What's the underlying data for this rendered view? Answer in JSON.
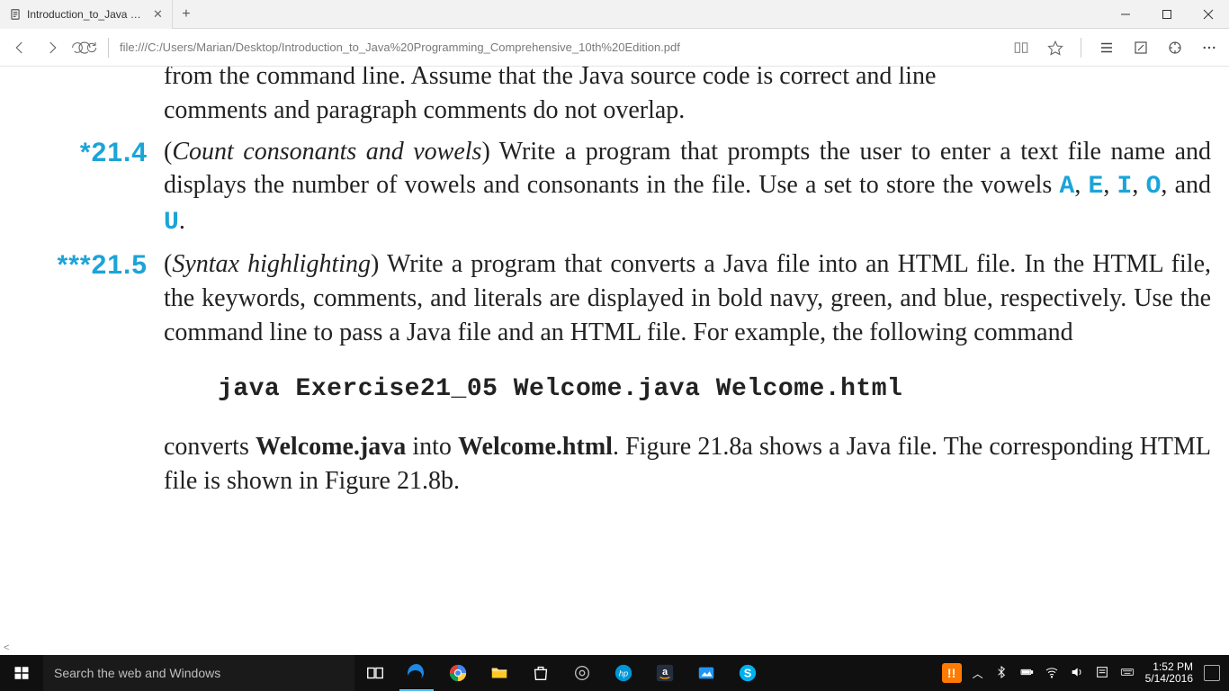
{
  "browser": {
    "tab_title": "Introduction_to_Java Prc",
    "address": "file:///C:/Users/Marian/Desktop/Introduction_to_Java%20Programming_Comprehensive_10th%20Edition.pdf"
  },
  "pdf": {
    "cut_line1": "from the command line. Assume that the Java source code is correct and line",
    "cut_line2": "comments and paragraph comments do not overlap.",
    "ex214": {
      "num": "*21.4",
      "title": "Count consonants and vowels",
      "body_a": ") Write a program that prompts the user to enter a text file name and displays the number of vowels and consonants in the file. Use a set to store the vowels ",
      "letters": [
        "A",
        "E",
        "I",
        "O",
        "U"
      ],
      "sep": ", ",
      "and": ", and ",
      "period": "."
    },
    "ex215": {
      "num": "***21.5",
      "title": "Syntax highlighting",
      "body_a": ") Write a program that converts a Java file into an HTML file. In the HTML file, the keywords, comments, and literals are displayed in bold navy, green, and blue, respectively. Use the command line to pass a Java file and an HTML file. For example, the following command",
      "command": "java Exercise21_05 Welcome.java Welcome.html",
      "after_a": "converts ",
      "bold1": "Welcome.java",
      "after_b": " into ",
      "bold2": "Welcome.html",
      "after_c": ". Figure 21.8a shows a Java file. The corresponding HTML file is shown in Figure 21.8b."
    }
  },
  "taskbar": {
    "search_placeholder": "Search the web and Windows",
    "time": "1:52 PM",
    "date": "5/14/2016"
  }
}
